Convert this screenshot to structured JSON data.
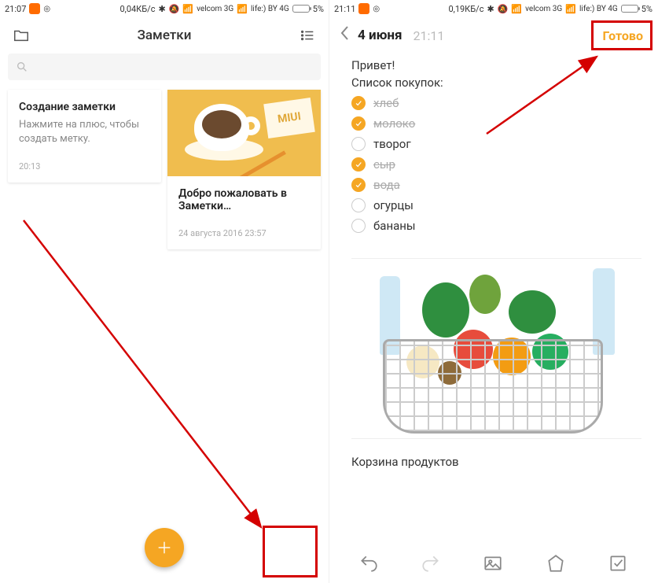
{
  "left": {
    "status": {
      "time": "21:07",
      "data_rate": "0,04КБ/с",
      "carrier1": "velcom 3G",
      "carrier2": "life:) BY 4G",
      "battery": "5%"
    },
    "header": {
      "title": "Заметки"
    },
    "cards": [
      {
        "title": "Создание заметки",
        "subtitle": "Нажмите на плюс, чтобы создать метку.",
        "timestamp": "20:13"
      },
      {
        "sticky_text": "MIUI",
        "title": "Добро пожаловать в Заметки…",
        "timestamp": "24 августа 2016 23:57"
      }
    ]
  },
  "right": {
    "status": {
      "time": "21:11",
      "data_rate": "0,19КБ/с",
      "carrier1": "velcom 3G",
      "carrier2": "life:) BY 4G",
      "battery": "5%"
    },
    "header": {
      "date": "4 июня",
      "time": "21:11",
      "done": "Готово"
    },
    "note": {
      "greeting": "Привет!",
      "list_title": "Список покупок:",
      "items": [
        {
          "label": "хлеб",
          "checked": true
        },
        {
          "label": "молоко",
          "checked": true
        },
        {
          "label": "творог",
          "checked": false
        },
        {
          "label": "сыр",
          "checked": true
        },
        {
          "label": "вода",
          "checked": true
        },
        {
          "label": "огурцы",
          "checked": false
        },
        {
          "label": "бананы",
          "checked": false
        }
      ],
      "caption": "Корзина продуктов"
    }
  },
  "colors": {
    "accent": "#f5a623",
    "annotation": "#d40000"
  }
}
